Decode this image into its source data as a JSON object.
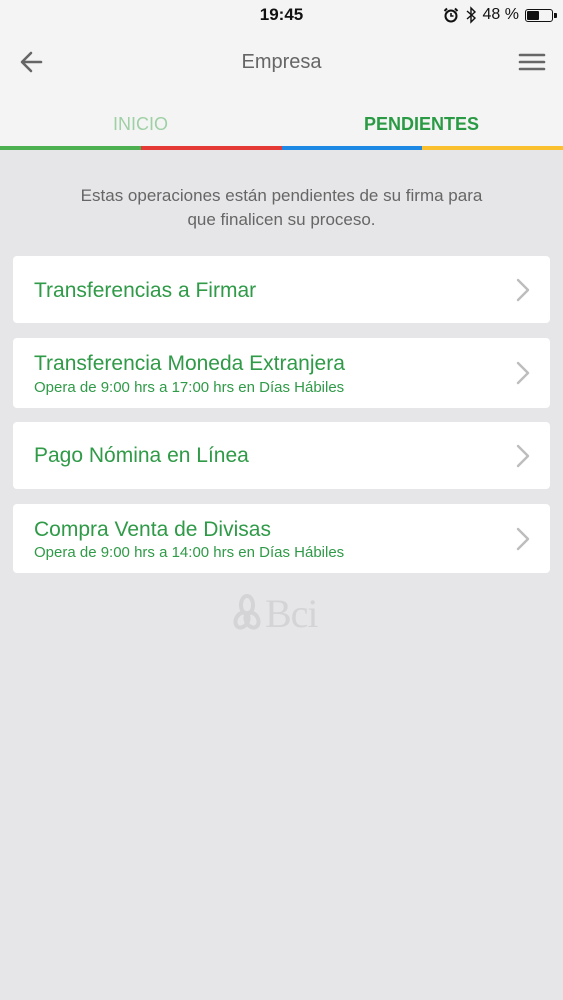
{
  "status": {
    "time": "19:45",
    "battery_text": "48 %",
    "battery_level": 0.48,
    "icons": [
      "alarm-icon",
      "bluetooth-icon",
      "battery-icon"
    ]
  },
  "header": {
    "title": "Empresa",
    "back_icon": "arrow-left-icon",
    "menu_icon": "hamburger-menu-icon"
  },
  "tabs": [
    {
      "label": "INICIO",
      "active": false
    },
    {
      "label": "PENDIENTES",
      "active": true
    }
  ],
  "tab_strip_colors": [
    "#4caf50",
    "#e53935",
    "#1e88e5",
    "#fbc02d"
  ],
  "intro": {
    "line1": "Estas operaciones están pendientes de su firma para",
    "line2": "que finalicen su proceso."
  },
  "items": [
    {
      "title": "Transferencias a Firmar",
      "subtitle": ""
    },
    {
      "title": "Transferencia Moneda Extranjera",
      "subtitle": "Opera de 9:00 hrs a 17:00 hrs en Días Hábiles"
    },
    {
      "title": "Pago Nómina en Línea",
      "subtitle": ""
    },
    {
      "title": "Compra Venta de Divisas",
      "subtitle": "Opera de 9:00 hrs a 14:00 hrs en Días Hábiles"
    }
  ],
  "logo": {
    "text": "Bci"
  },
  "colors": {
    "accent_green": "#2f9a47",
    "inactive_tab_green": "#9fd0a5",
    "background": "#e6e6e8"
  }
}
